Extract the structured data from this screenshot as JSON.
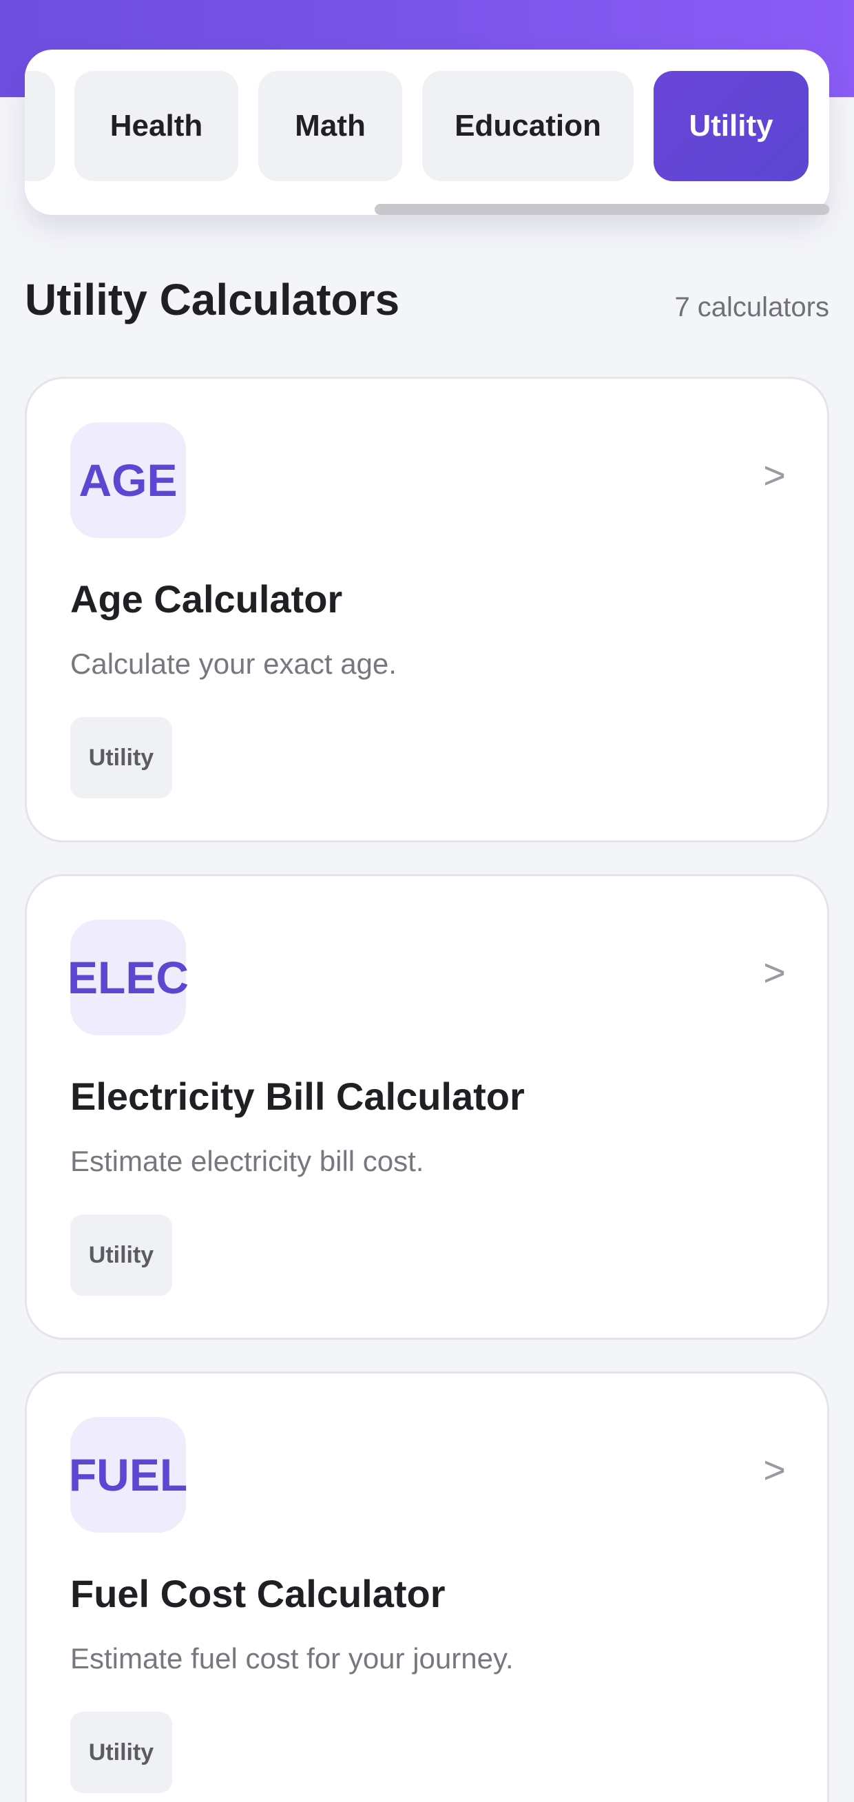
{
  "colors": {
    "brand_gradient_start": "#6d4ee0",
    "brand_gradient_end": "#8b5cf6",
    "accent": "#5b47d2",
    "badge_bg": "#efecfd",
    "page_bg": "#f4f5f9"
  },
  "tabs": [
    {
      "label": "",
      "active": false
    },
    {
      "label": "Health",
      "active": false
    },
    {
      "label": "Math",
      "active": false
    },
    {
      "label": "Education",
      "active": false
    },
    {
      "label": "Utility",
      "active": true
    }
  ],
  "section": {
    "title": "Utility Calculators",
    "count": "7 calculators"
  },
  "cards": [
    {
      "badge": "AGE",
      "title": "Age Calculator",
      "description": "Calculate your exact age.",
      "tag": "Utility",
      "chevron": ">"
    },
    {
      "badge": "ELEC",
      "title": "Electricity Bill Calculator",
      "description": "Estimate electricity bill cost.",
      "tag": "Utility",
      "chevron": ">"
    },
    {
      "badge": "FUEL",
      "title": "Fuel Cost Calculator",
      "description": "Estimate fuel cost for your journey.",
      "tag": "Utility",
      "chevron": ">"
    }
  ]
}
